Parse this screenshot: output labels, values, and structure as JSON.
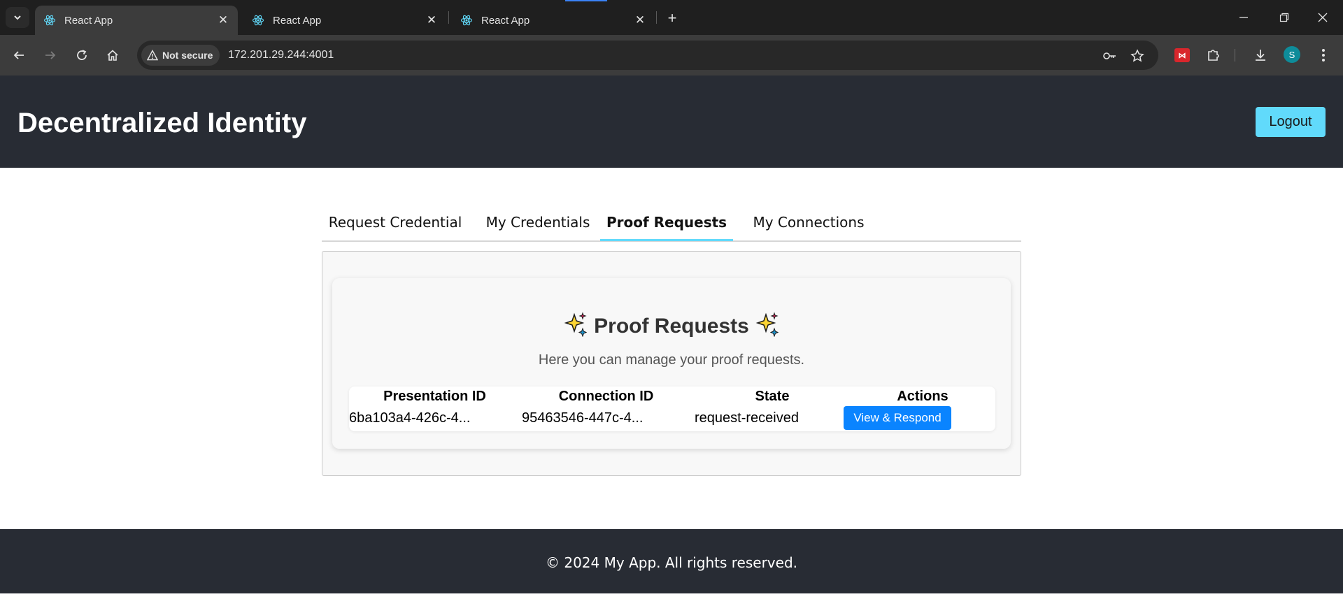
{
  "browser": {
    "tabs": [
      {
        "title": "React App",
        "active": true
      },
      {
        "title": "React App",
        "active": false
      },
      {
        "title": "React App",
        "active": false
      }
    ],
    "security_label": "Not secure",
    "url": "172.201.29.244:4001",
    "profile_initial": "S"
  },
  "app": {
    "title": "Decentralized Identity",
    "logout_label": "Logout",
    "nav_tabs": [
      "Request Credential",
      "My Credentials",
      "Proof Requests",
      "My Connections"
    ],
    "active_tab": "Proof Requests",
    "heading": "Proof Requests",
    "subtitle": "Here you can manage your proof requests.",
    "table": {
      "headers": [
        "Presentation ID",
        "Connection ID",
        "State",
        "Actions"
      ],
      "rows": [
        {
          "presentation_id": "6ba103a4-426c-4...",
          "connection_id": "95463546-447c-4...",
          "state": "request-received",
          "action_label": "View & Respond"
        }
      ]
    },
    "footer": "© 2024 My App. All rights reserved."
  },
  "colors": {
    "header_bg": "#282c34",
    "accent": "#61dafb",
    "primary_button": "#0a84ff"
  }
}
